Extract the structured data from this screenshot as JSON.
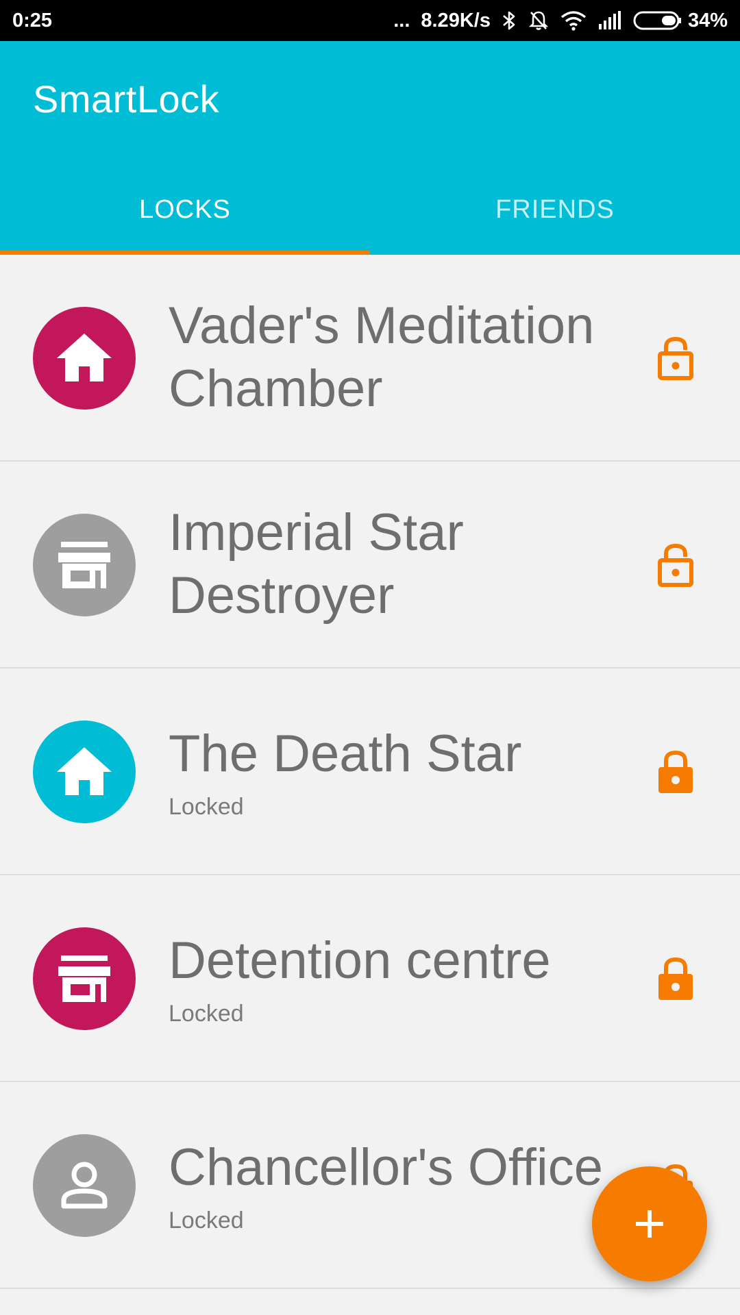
{
  "status_bar": {
    "time": "0:25",
    "dots": "...",
    "network_speed": "8.29K/s",
    "battery_percent": "34%",
    "battery_level": 0.34,
    "icons": [
      "bluetooth-icon",
      "mute-bell-icon",
      "wifi-icon",
      "signal-icon",
      "battery-icon"
    ]
  },
  "app": {
    "title": "SmartLock",
    "primary_color": "#00bcd4",
    "accent_color": "#f57c00"
  },
  "tabs": [
    {
      "label": "LOCKS",
      "active": true
    },
    {
      "label": "FRIENDS",
      "active": false
    }
  ],
  "locks": [
    {
      "name": "Vader's Meditation Chamber",
      "status": "",
      "icon": "home-icon",
      "icon_color": "#c2185b",
      "lock_state": "unlocked"
    },
    {
      "name": "Imperial Star Destroyer",
      "status": "",
      "icon": "store-icon",
      "icon_color": "#9e9e9e",
      "lock_state": "unlocked"
    },
    {
      "name": "The Death Star",
      "status": "Locked",
      "icon": "home-icon",
      "icon_color": "#00bcd4",
      "lock_state": "locked"
    },
    {
      "name": "Detention centre",
      "status": "Locked",
      "icon": "store-icon",
      "icon_color": "#c2185b",
      "lock_state": "locked"
    },
    {
      "name": "Chancellor's Office",
      "status": "Locked",
      "icon": "person-icon",
      "icon_color": "#9e9e9e",
      "lock_state": "locked"
    }
  ],
  "fab": {
    "icon": "plus-icon"
  }
}
